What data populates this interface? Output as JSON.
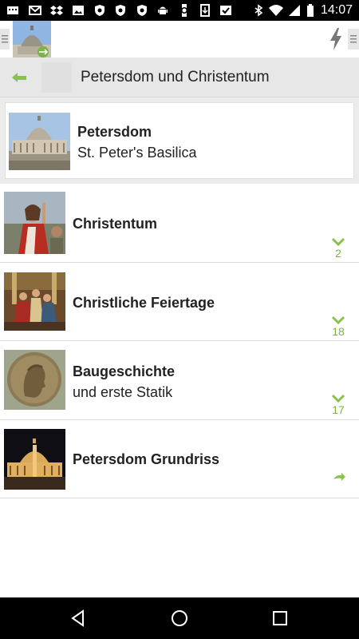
{
  "statusbar": {
    "time": "14:07",
    "icons": [
      "messages-icon",
      "gmail-icon",
      "dropbox-icon",
      "image-icon",
      "shield-icon",
      "shield-icon",
      "shield-icon",
      "android-icon",
      "watch-icon",
      "download-icon",
      "check-icon",
      "bluetooth-icon",
      "wifi-icon",
      "signal-icon",
      "battery-icon"
    ]
  },
  "appbar": {
    "menu_left_icon": "menu-icon",
    "logo": "petersdom-app-logo",
    "bolt_icon": "bolt-icon",
    "menu_right_icon": "menu-icon"
  },
  "titlebar": {
    "back_icon": "back-arrow-icon",
    "title": "Petersdom und Christentum"
  },
  "header": {
    "title": "Petersdom",
    "subtitle": "St. Peter's Basilica",
    "image": "st-peters-basilica-photo"
  },
  "items": [
    {
      "title": "Christentum",
      "subtitle": "",
      "count": "2",
      "indicator": "chevron-down-icon",
      "image": "christ-painting"
    },
    {
      "title": "Christliche Feiertage",
      "subtitle": "",
      "count": "18",
      "indicator": "chevron-down-icon",
      "image": "feast-painting"
    },
    {
      "title": "Baugeschichte",
      "subtitle": "und erste Statik",
      "count": "17",
      "indicator": "chevron-down-icon",
      "image": "bronze-medal"
    },
    {
      "title": "Petersdom Grundriss",
      "subtitle": "",
      "count": "",
      "indicator": "arrow-right-icon",
      "image": "basilica-night-photo"
    }
  ],
  "colors": {
    "accent": "#8bc34a",
    "titlebar_bg": "#e7e7e7",
    "statusbar_bg": "#000000"
  },
  "navbar": {
    "back_icon": "nav-back-icon",
    "home_icon": "nav-home-icon",
    "recents_icon": "nav-recents-icon"
  }
}
